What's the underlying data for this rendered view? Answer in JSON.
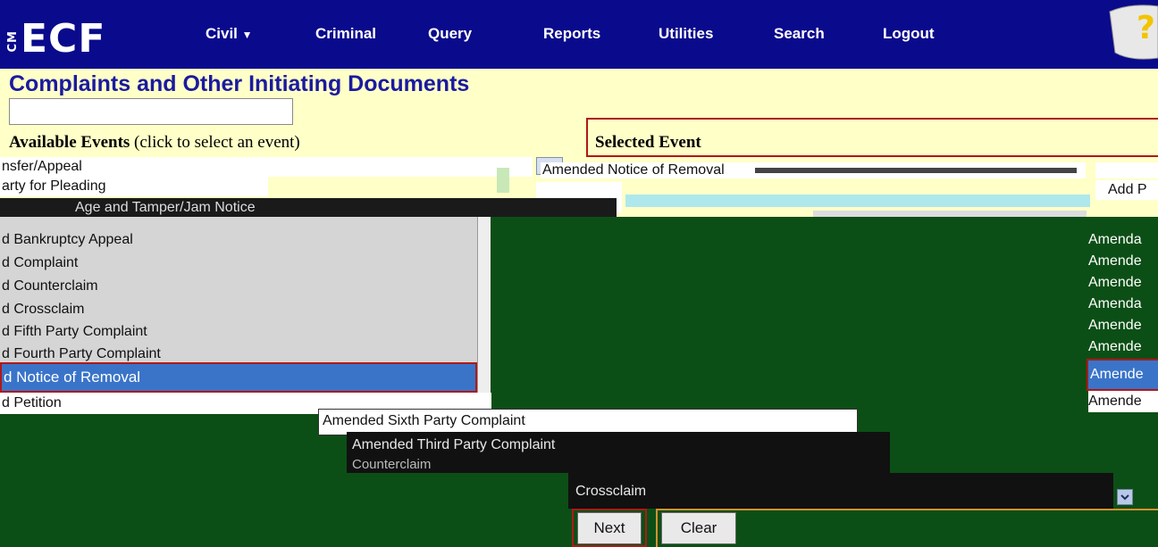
{
  "app": {
    "logo_text": "ECF",
    "logo_prefix": "CM"
  },
  "nav": {
    "items": [
      "Civil",
      "Criminal",
      "Query",
      "Reports",
      "Utilities",
      "Search",
      "Logout"
    ],
    "civil_caret": "▼",
    "help_glyph": "?"
  },
  "page": {
    "title": "Complaints and Other Initiating Documents",
    "filter_value": "",
    "available_label": "Available Events",
    "available_hint": "(click to select an event)",
    "selected_label": "Selected Event"
  },
  "strips": {
    "row1_left": "nsfer/Appeal",
    "row1_mid": "Amended Notice of Removal",
    "row2_left": "arty for Pleading",
    "row3_left": "Age and Tamper/Jam Notice"
  },
  "available_events": [
    "d Bankruptcy Appeal",
    "d Complaint",
    "d Counterclaim",
    "d Crossclaim",
    "d Fifth Party Complaint",
    "d Fourth Party Complaint",
    "d Notice of Removal",
    "d Petition"
  ],
  "right_list": {
    "top_fragment": "Add P",
    "items": [
      "Amenda",
      "Amende",
      "Amende",
      "Amenda",
      "Amende",
      "Amende",
      "Amende",
      "Amende"
    ],
    "selected": "Amende"
  },
  "lower_items": {
    "sixth": "Amended Sixth Party Complaint",
    "third": "Amended Third Party Complaint",
    "counterclaim": "Counterclaim",
    "crossclaim": "Crossclaim"
  },
  "buttons": {
    "next": "Next",
    "clear": "Clear"
  },
  "colors": {
    "nav_bg": "#0a0a8c",
    "page_bg": "#ffffc8",
    "body_green": "#0c4f16",
    "selection": "#3a74c9",
    "highlight_border": "#b01818"
  }
}
